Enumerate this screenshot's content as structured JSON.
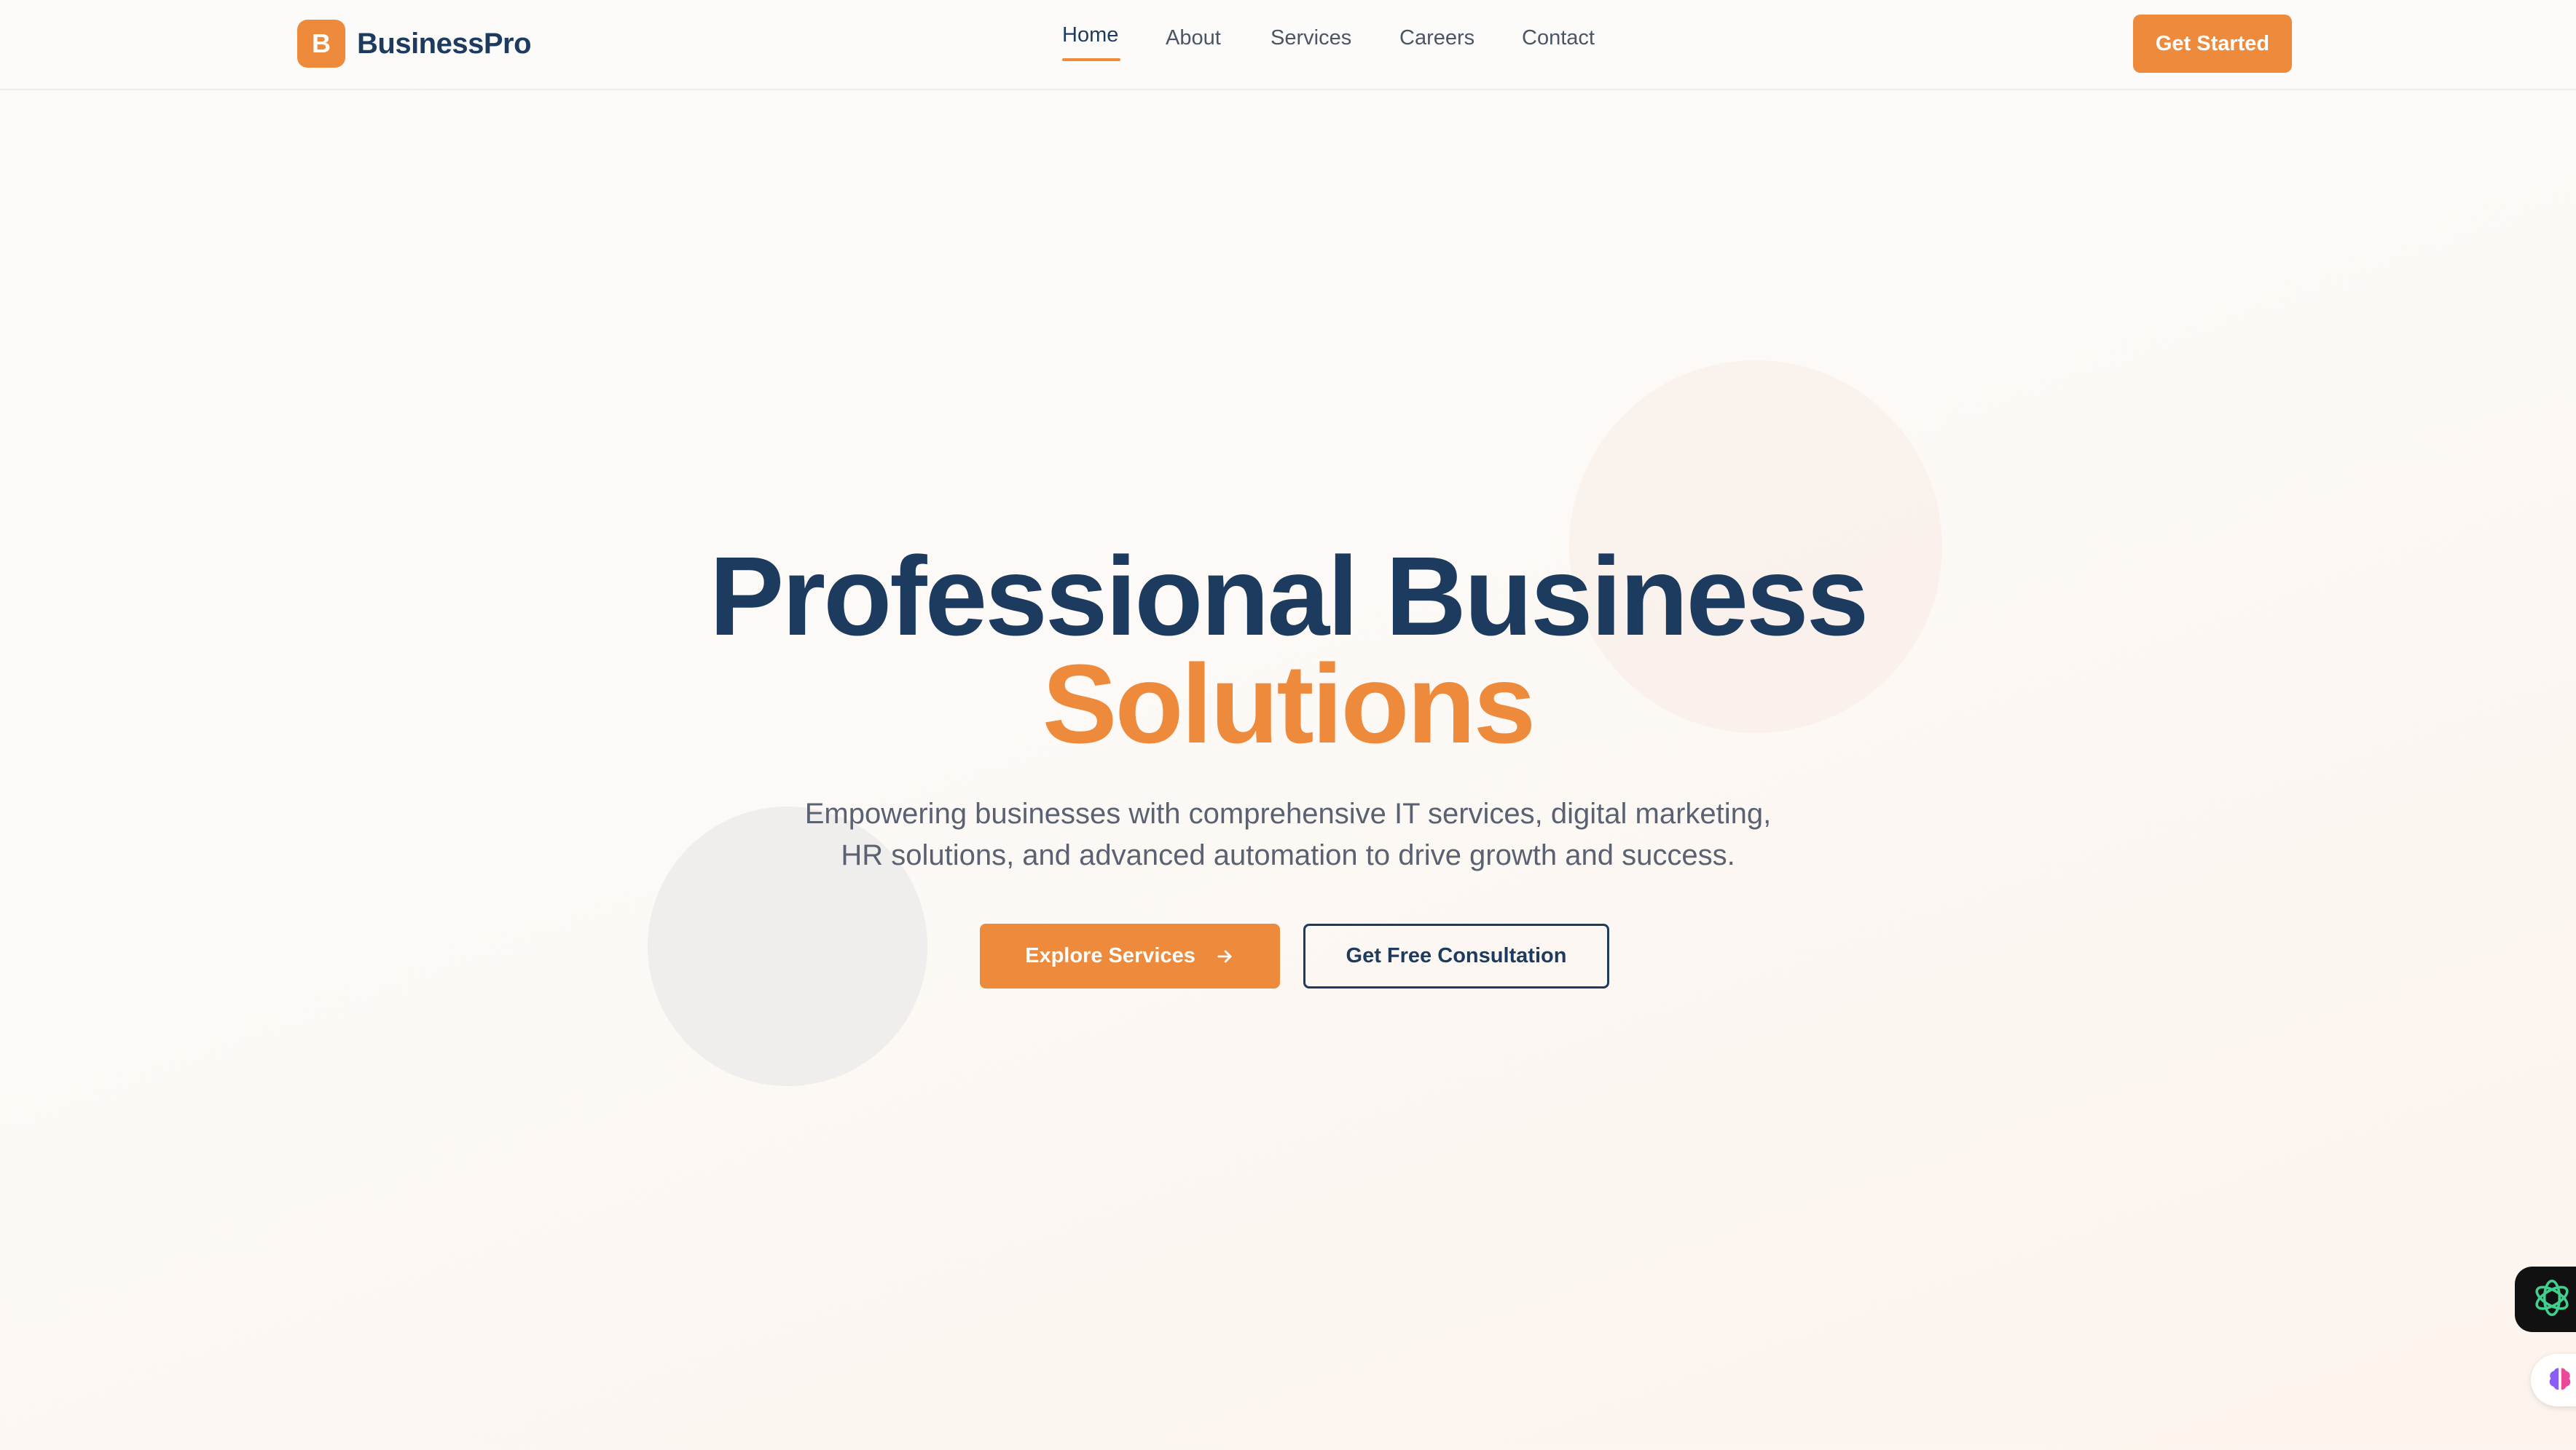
{
  "header": {
    "logo_letter": "B",
    "brand_name": "BusinessPro",
    "nav": [
      {
        "label": "Home",
        "active": true
      },
      {
        "label": "About",
        "active": false
      },
      {
        "label": "Services",
        "active": false
      },
      {
        "label": "Careers",
        "active": false
      },
      {
        "label": "Contact",
        "active": false
      }
    ],
    "cta_label": "Get Started"
  },
  "hero": {
    "title_line1": "Professional Business",
    "title_line2": "Solutions",
    "subtitle_line1": "Empowering businesses with comprehensive IT services, digital marketing,",
    "subtitle_line2": "HR solutions, and advanced automation to drive growth and success.",
    "primary_button": "Explore Services",
    "secondary_button": "Get Free Consultation"
  },
  "widgets": {
    "chat_icon": "openai-knot-icon",
    "assistant_icon": "brain-icon"
  },
  "colors": {
    "accent": "#ee8a3c",
    "navy": "#1c3b5e",
    "text_muted": "#5a6272"
  }
}
